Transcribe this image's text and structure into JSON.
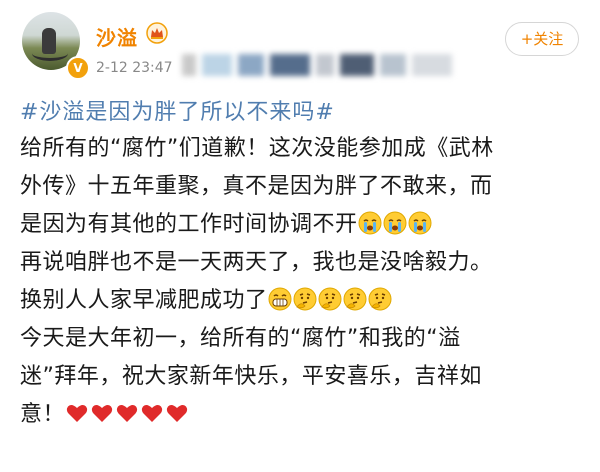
{
  "post": {
    "username": "沙溢",
    "timestamp": "2-12 23:47",
    "follow_label": "+关注",
    "topic": "#沙溢是因为胖了所以不来吗#",
    "lines": [
      "给所有的“腐竹”们道歉！这次没能参加成《武林",
      "外传》十五年重聚，真不是因为胖了不敢来，而",
      "是因为有其他的工作时间协调不开",
      "再说咱胖也不是一天两天了，我也是没啥毅力。",
      "换别人人家早减肥成功了",
      "今天是大年初一，给所有的“腐竹”和我的“溢",
      "迷”拜年，祝大家新年快乐，平安喜乐，吉祥如",
      "意！"
    ]
  },
  "icons": {
    "avatar": "avatar-photo",
    "verify": "orange-verified-badge",
    "crown": "gold-crown-icon",
    "cry": "crying-face-emoji",
    "grin": "grinning-face-emoji",
    "think": "thinking-face-emoji",
    "heart": "red-heart-emoji"
  },
  "colors": {
    "username": "#f08300",
    "topic": "#507daf",
    "text": "#1a1a1a",
    "timestamp": "#888888",
    "heart": "#e02a2a"
  }
}
